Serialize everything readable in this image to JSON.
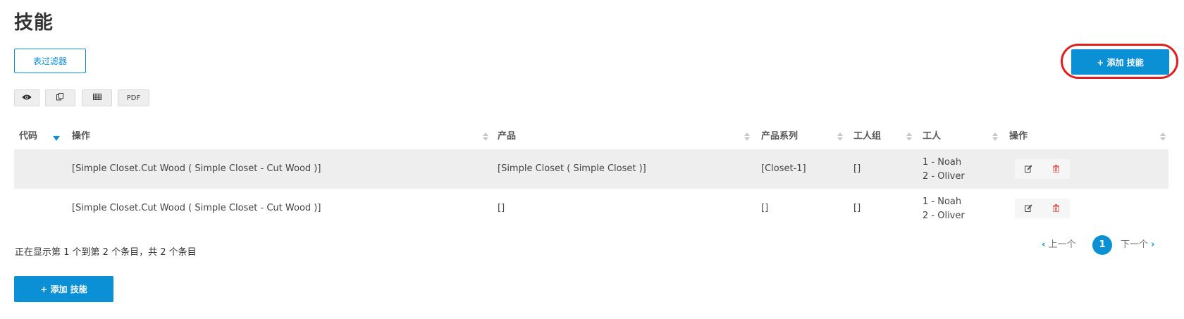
{
  "page": {
    "title": "技能"
  },
  "toolbar": {
    "filter_label": "表过滤器",
    "add_label": "+ 添加 技能",
    "export_buttons": [
      {
        "icon": "eye-icon"
      },
      {
        "icon": "copy-icon"
      },
      {
        "icon": "table-icon"
      },
      {
        "label": "PDF"
      }
    ]
  },
  "table": {
    "columns": [
      "代码",
      "操作",
      "产品",
      "产品系列",
      "工人组",
      "工人",
      "操作"
    ],
    "rows": [
      {
        "code": "",
        "operation": "[Simple Closet.Cut Wood ( Simple Closet - Cut Wood )]",
        "product": "[Simple Closet ( Simple Closet )]",
        "product_series": "[Closet-1]",
        "worker_group": "[]",
        "workers": [
          "1 - Noah",
          "2 - Oliver"
        ]
      },
      {
        "code": "",
        "operation": "[Simple Closet.Cut Wood ( Simple Closet - Cut Wood )]",
        "product": "[]",
        "product_series": "[]",
        "worker_group": "[]",
        "workers": [
          "1 - Noah",
          "2 - Oliver"
        ]
      }
    ]
  },
  "footer": {
    "info": "正在显示第 1 个到第 2 个条目，共 2 个条目",
    "pagination": {
      "prev": "上一个",
      "current": "1",
      "next": "下一个"
    },
    "add_label": "+ 添加 技能"
  },
  "colors": {
    "accent": "#0b90d5",
    "highlight": "#e21f1f",
    "row_alt": "#eeeeee",
    "delete": "#e05a5a"
  }
}
